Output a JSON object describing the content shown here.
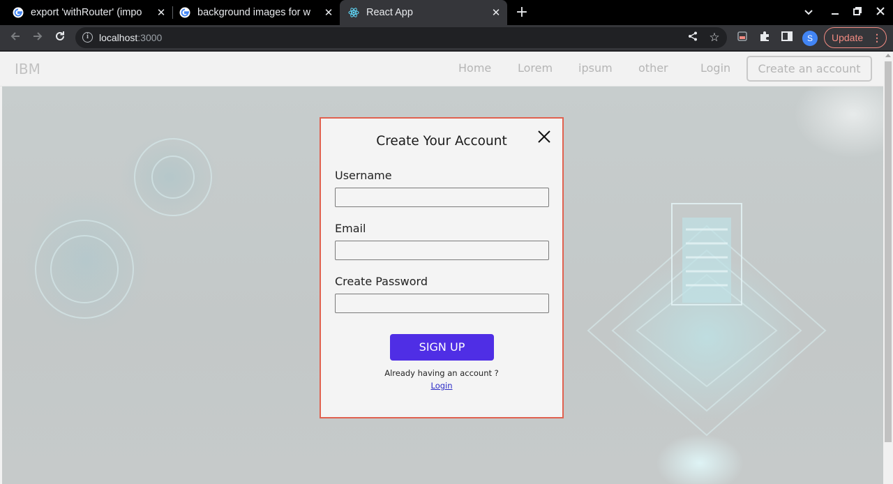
{
  "browser": {
    "tabs": [
      {
        "title": "export 'withRouter' (impo",
        "favicon": "google-icon"
      },
      {
        "title": "background images for w",
        "favicon": "google-icon"
      },
      {
        "title": "React App",
        "favicon": "react-icon",
        "active": true
      }
    ],
    "url_host": "localhost",
    "url_port": ":3000",
    "profile_initial": "S",
    "update_label": "Update",
    "colors": {
      "update": "#f28b82",
      "profile": "#4285f4"
    }
  },
  "page": {
    "brand": "IBM",
    "nav": [
      "Home",
      "Lorem",
      "ipsum",
      "other"
    ],
    "login": "Login",
    "cta": "Create an account"
  },
  "modal": {
    "title": "Create Your Account",
    "fields": [
      {
        "label": "Username",
        "value": ""
      },
      {
        "label": "Email",
        "value": ""
      },
      {
        "label": "Create Password",
        "value": ""
      }
    ],
    "submit": "SIGN UP",
    "already": "Already having an account ?",
    "login_link": "Login",
    "colors": {
      "border": "#e0614f",
      "button": "#4f2ee5",
      "link": "#2a2ac6"
    }
  }
}
